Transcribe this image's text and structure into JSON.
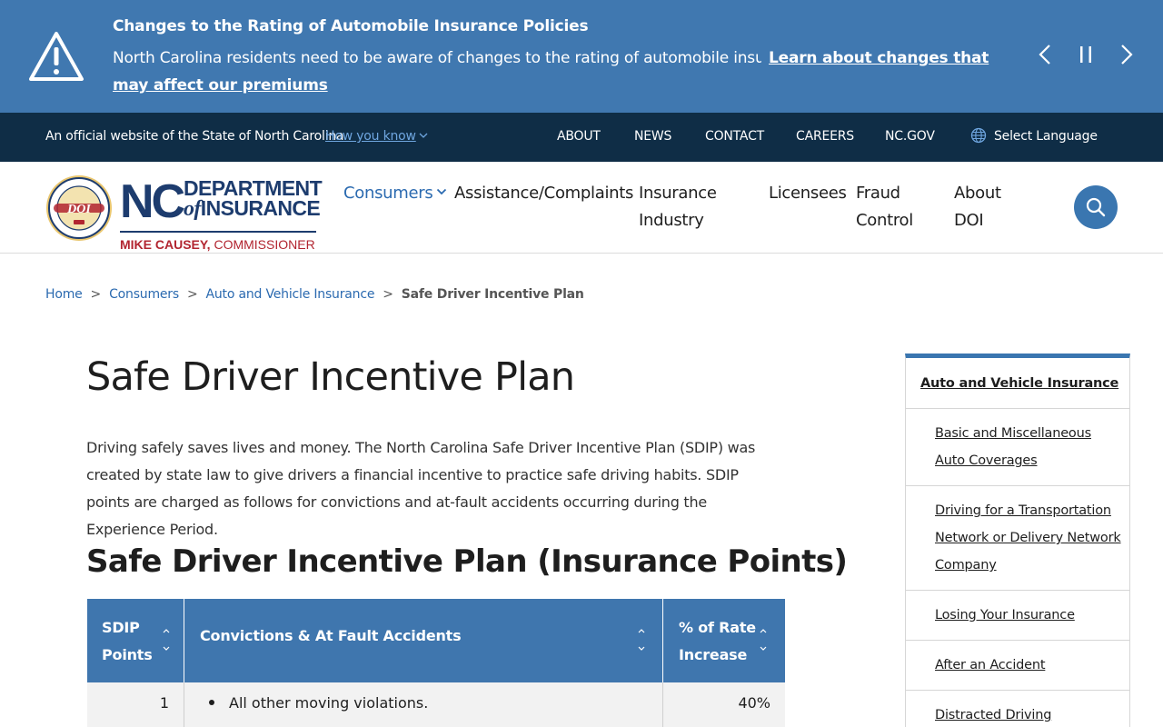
{
  "alert": {
    "title": "Changes to the Rating of Automobile Insurance Policies",
    "body": "North Carolina residents need to be aware of changes to the rating of automobile insurance poli",
    "link": "Learn about changes that may affect our premiums",
    "icon": "warning-triangle-icon",
    "controls": [
      "prev-arrow-icon",
      "pause-icon",
      "next-arrow-icon"
    ]
  },
  "official_bar": {
    "text": "An official website of the State of North Carolina",
    "how_know": "How you know",
    "links": [
      "ABOUT",
      "NEWS",
      "CONTACT",
      "CAREERS",
      "NC.GOV"
    ],
    "language": "Select Language"
  },
  "logo": {
    "nc": "NC",
    "dept_line1": "DEPARTMENT",
    "dept_of": "of",
    "dept_line2": "INSURANCE",
    "commissioner_name": "MIKE CAUSEY,",
    "commissioner_title": "COMMISSIONER",
    "seal_text": "DOI"
  },
  "nav": {
    "items": [
      "Consumers",
      "Assistance/Complaints",
      "Insurance Industry",
      "Licensees",
      "Fraud Control",
      "About DOI"
    ],
    "active": "Consumers"
  },
  "breadcrumb": {
    "items": [
      "Home",
      "Consumers",
      "Auto and Vehicle Insurance"
    ],
    "current": "Safe Driver Incentive Plan",
    "separator": ">"
  },
  "main": {
    "title": "Safe Driver Incentive Plan",
    "intro": "Driving safely saves lives and money. The North Carolina Safe Driver Incentive Plan (SDIP) was created by state law to give drivers a financial incentive to practice safe driving habits. SDIP points are charged as follows for convictions and at-fault accidents occurring during the Experience Period.",
    "section_title": "Safe Driver Incentive Plan (Insurance Points)",
    "table": {
      "headers": [
        "SDIP Points",
        "Convictions & At Fault Accidents",
        "% of Rate Increase"
      ],
      "rows": [
        {
          "points": "1",
          "violation": "All other moving violations.",
          "increase": "40%"
        }
      ]
    }
  },
  "sidenav": {
    "header": "Auto and Vehicle Insurance",
    "items": [
      "Basic and Miscellaneous Auto Coverages",
      "Driving for a Transportation Network or Delivery Network Company",
      "Losing Your Insurance",
      "After an Accident",
      "Distracted Driving Awareness"
    ]
  },
  "colors": {
    "banner_blue": "#4078b0",
    "official_bar": "#0f2d46",
    "link_blue": "#2b6ab0",
    "table_header": "#3f76ae",
    "brand_navy": "#1d3c6e",
    "brand_red": "#b22530"
  }
}
